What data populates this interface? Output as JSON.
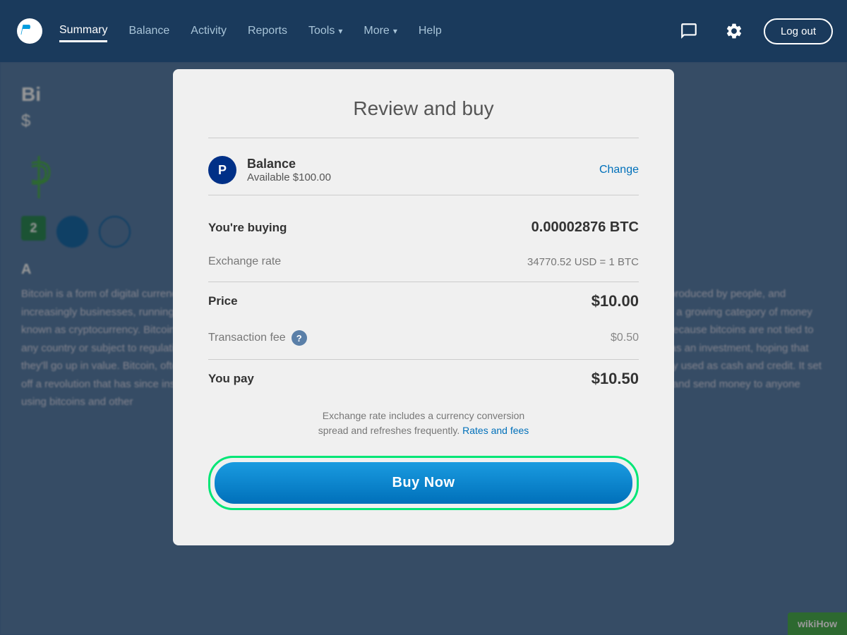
{
  "navbar": {
    "logo_letter": "P",
    "items": [
      {
        "label": "Summary",
        "active": true
      },
      {
        "label": "Balance",
        "active": false
      },
      {
        "label": "Activity",
        "active": false
      },
      {
        "label": "Reports",
        "active": false
      },
      {
        "label": "Tools",
        "active": false,
        "has_dropdown": true
      },
      {
        "label": "More",
        "active": false,
        "has_dropdown": true
      },
      {
        "label": "Help",
        "active": false
      }
    ],
    "message_icon": "💬",
    "settings_icon": "⚙",
    "logout_label": "Log out"
  },
  "background": {
    "title": "Bi",
    "amount": "$",
    "step_number": "2",
    "paragraph": "Bitcoin is a form of digital currency, created and held electronically. No one controls it. Bitcoins aren't printed, like dollars or euros – they're produced by people, and increasingly businesses, running computers all around the world, using software that solves mathematical problems. It's the first example of a growing category of money known as cryptocurrency. Bitcoins can be used to buy merchandise anonymously. In addition, international payments are easy and cheap because bitcoins are not tied to any country or subject to regulation. Small businesses may like them because there are no credit card fees. Some people just buy bitcoins as an investment, hoping that they'll go up in value. Bitcoin, often described as a cryptocurrency, a virtual currency or a digital currency - is a type of money that is comonly used as cash and credit. It set off a revolution that has since inspired thousands of variations on the original. Someday soon, you might be able to buy just about anything and send money to anyone using bitcoins and other"
  },
  "modal": {
    "title": "Review and buy",
    "divider": true,
    "payment_method": {
      "name": "Balance",
      "available": "Available $100.00",
      "change_label": "Change"
    },
    "rows": [
      {
        "label": "You're buying",
        "label_bold": true,
        "value": "0.00002876 BTC",
        "value_bold": true
      },
      {
        "label": "Exchange rate",
        "label_muted": true,
        "value": "34770.52 USD = 1 BTC",
        "value_muted": true
      },
      {
        "label": "Price",
        "label_bold": true,
        "value": "$10.00",
        "value_large_bold": true
      },
      {
        "label": "Transaction fee",
        "label_muted": true,
        "has_help": true,
        "value": "$0.50",
        "value_muted": true
      },
      {
        "label": "You pay",
        "label_bold": true,
        "value": "$10.50",
        "value_large_bold": true
      }
    ],
    "info_text": "Exchange rate includes a currency conversion\nspread and refreshes frequently.",
    "rates_link_label": "Rates and fees",
    "buy_button_label": "Buy Now"
  },
  "wikihow": {
    "label": "wikiHow"
  }
}
